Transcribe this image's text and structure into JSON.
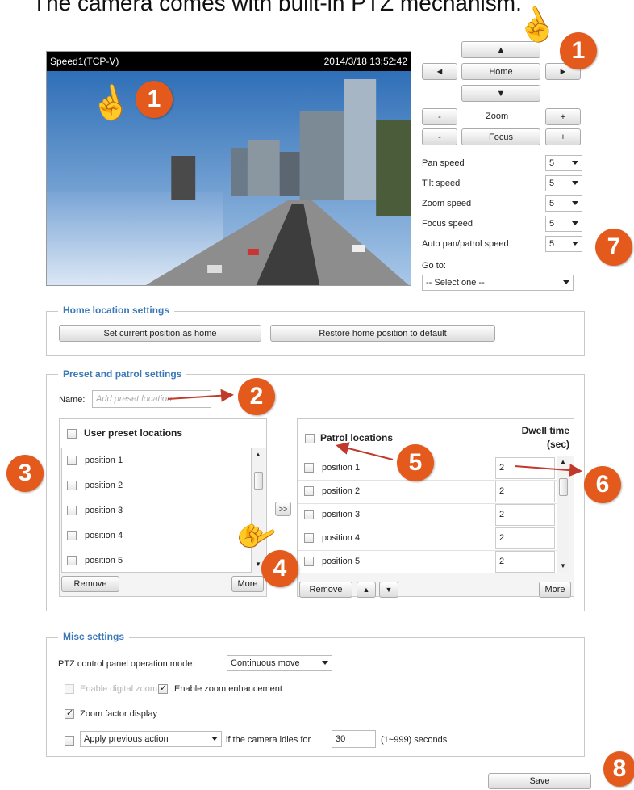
{
  "caption": "The camera comes with built-in PTZ mechanism.",
  "video": {
    "stream_name": "Speed1(TCP-V)",
    "timestamp": "2014/3/18 13:52:42"
  },
  "ptz": {
    "up_symbol": "▲",
    "down_symbol": "▼",
    "left_symbol": "◄",
    "right_symbol": "►",
    "home_label": "Home",
    "zoom_label": "Zoom",
    "focus_label": "Focus",
    "minus": "-",
    "plus": "+",
    "speeds": [
      {
        "label": "Pan speed",
        "value": "5"
      },
      {
        "label": "Tilt speed",
        "value": "5"
      },
      {
        "label": "Zoom speed",
        "value": "5"
      },
      {
        "label": "Focus speed",
        "value": "5"
      },
      {
        "label": "Auto pan/patrol speed",
        "value": "5"
      }
    ],
    "goto_label": "Go to:",
    "goto_value": "-- Select one --"
  },
  "home_settings": {
    "title": "Home location settings",
    "set_home_label": "Set current position as home",
    "restore_label": "Restore home position to default"
  },
  "preset": {
    "title": "Preset and patrol settings",
    "name_label": "Name:",
    "name_placeholder": "Add preset location",
    "user_header": "User preset locations",
    "user_items": [
      "position 1",
      "position 2",
      "position 3",
      "position 4",
      "position 5"
    ],
    "transfer_label": ">>",
    "remove_label": "Remove",
    "more_label": "More",
    "patrol_header": "Patrol locations",
    "dwell_header_1": "Dwell time",
    "dwell_header_2": "(sec)",
    "patrol_items": [
      {
        "name": "position 1",
        "dwell": "2"
      },
      {
        "name": "position 2",
        "dwell": "2"
      },
      {
        "name": "position 3",
        "dwell": "2"
      },
      {
        "name": "position 4",
        "dwell": "2"
      },
      {
        "name": "position 5",
        "dwell": "2"
      }
    ],
    "patrol_remove_label": "Remove",
    "patrol_up": "▲",
    "patrol_down": "▼",
    "patrol_more_label": "More"
  },
  "misc": {
    "title": "Misc settings",
    "ptz_mode_label": "PTZ control panel operation mode:",
    "ptz_mode_value": "Continuous move",
    "digital_zoom_label": "Enable digital zoom",
    "zoom_enh_label": "Enable zoom enhancement",
    "zoom_factor_label": "Zoom factor display",
    "idle_action_value": "Apply previous action",
    "idle_text": "if the camera idles for",
    "idle_seconds": "30",
    "idle_range": "(1~999) seconds"
  },
  "save_label": "Save",
  "callouts": [
    "1",
    "1",
    "2",
    "3",
    "4",
    "5",
    "6",
    "7",
    "8"
  ],
  "colors": {
    "accent": "#3a78b8",
    "callout": "#e35a1c",
    "arrow": "#c0392b"
  }
}
